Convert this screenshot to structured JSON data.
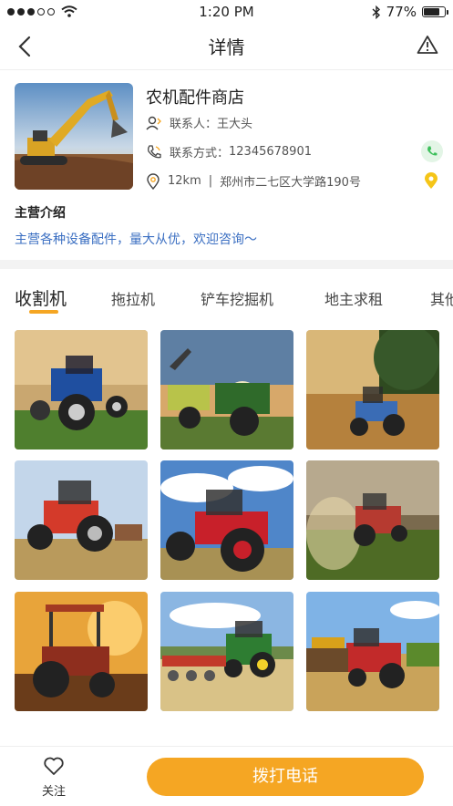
{
  "status": {
    "time": "1:20 PM",
    "battery": "77%",
    "battery_level": 0.77
  },
  "nav": {
    "title": "详情"
  },
  "shop": {
    "name": "农机配件商店",
    "contact_label": "联系人：",
    "contact_name": "王大头",
    "phone_label": "联系方式：",
    "phone": "12345678901",
    "distance": "12km",
    "separator": "|",
    "address": "郑州市二七区大学路190号"
  },
  "intro": {
    "title": "主营介绍",
    "text": "主营各种设备配件，量大从优，欢迎咨询～"
  },
  "tabs": [
    {
      "label": "收割机",
      "active": true
    },
    {
      "label": "拖拉机",
      "active": false
    },
    {
      "label": "铲车挖掘机",
      "active": false
    },
    {
      "label": "地主求租",
      "active": false
    },
    {
      "label": "其他",
      "active": false
    }
  ],
  "bottom": {
    "follow_label": "关注",
    "call_label": "拨打电话"
  },
  "colors": {
    "accent": "#f5a623",
    "link": "#3b6fc2",
    "phone_green": "#3cbf5a"
  }
}
